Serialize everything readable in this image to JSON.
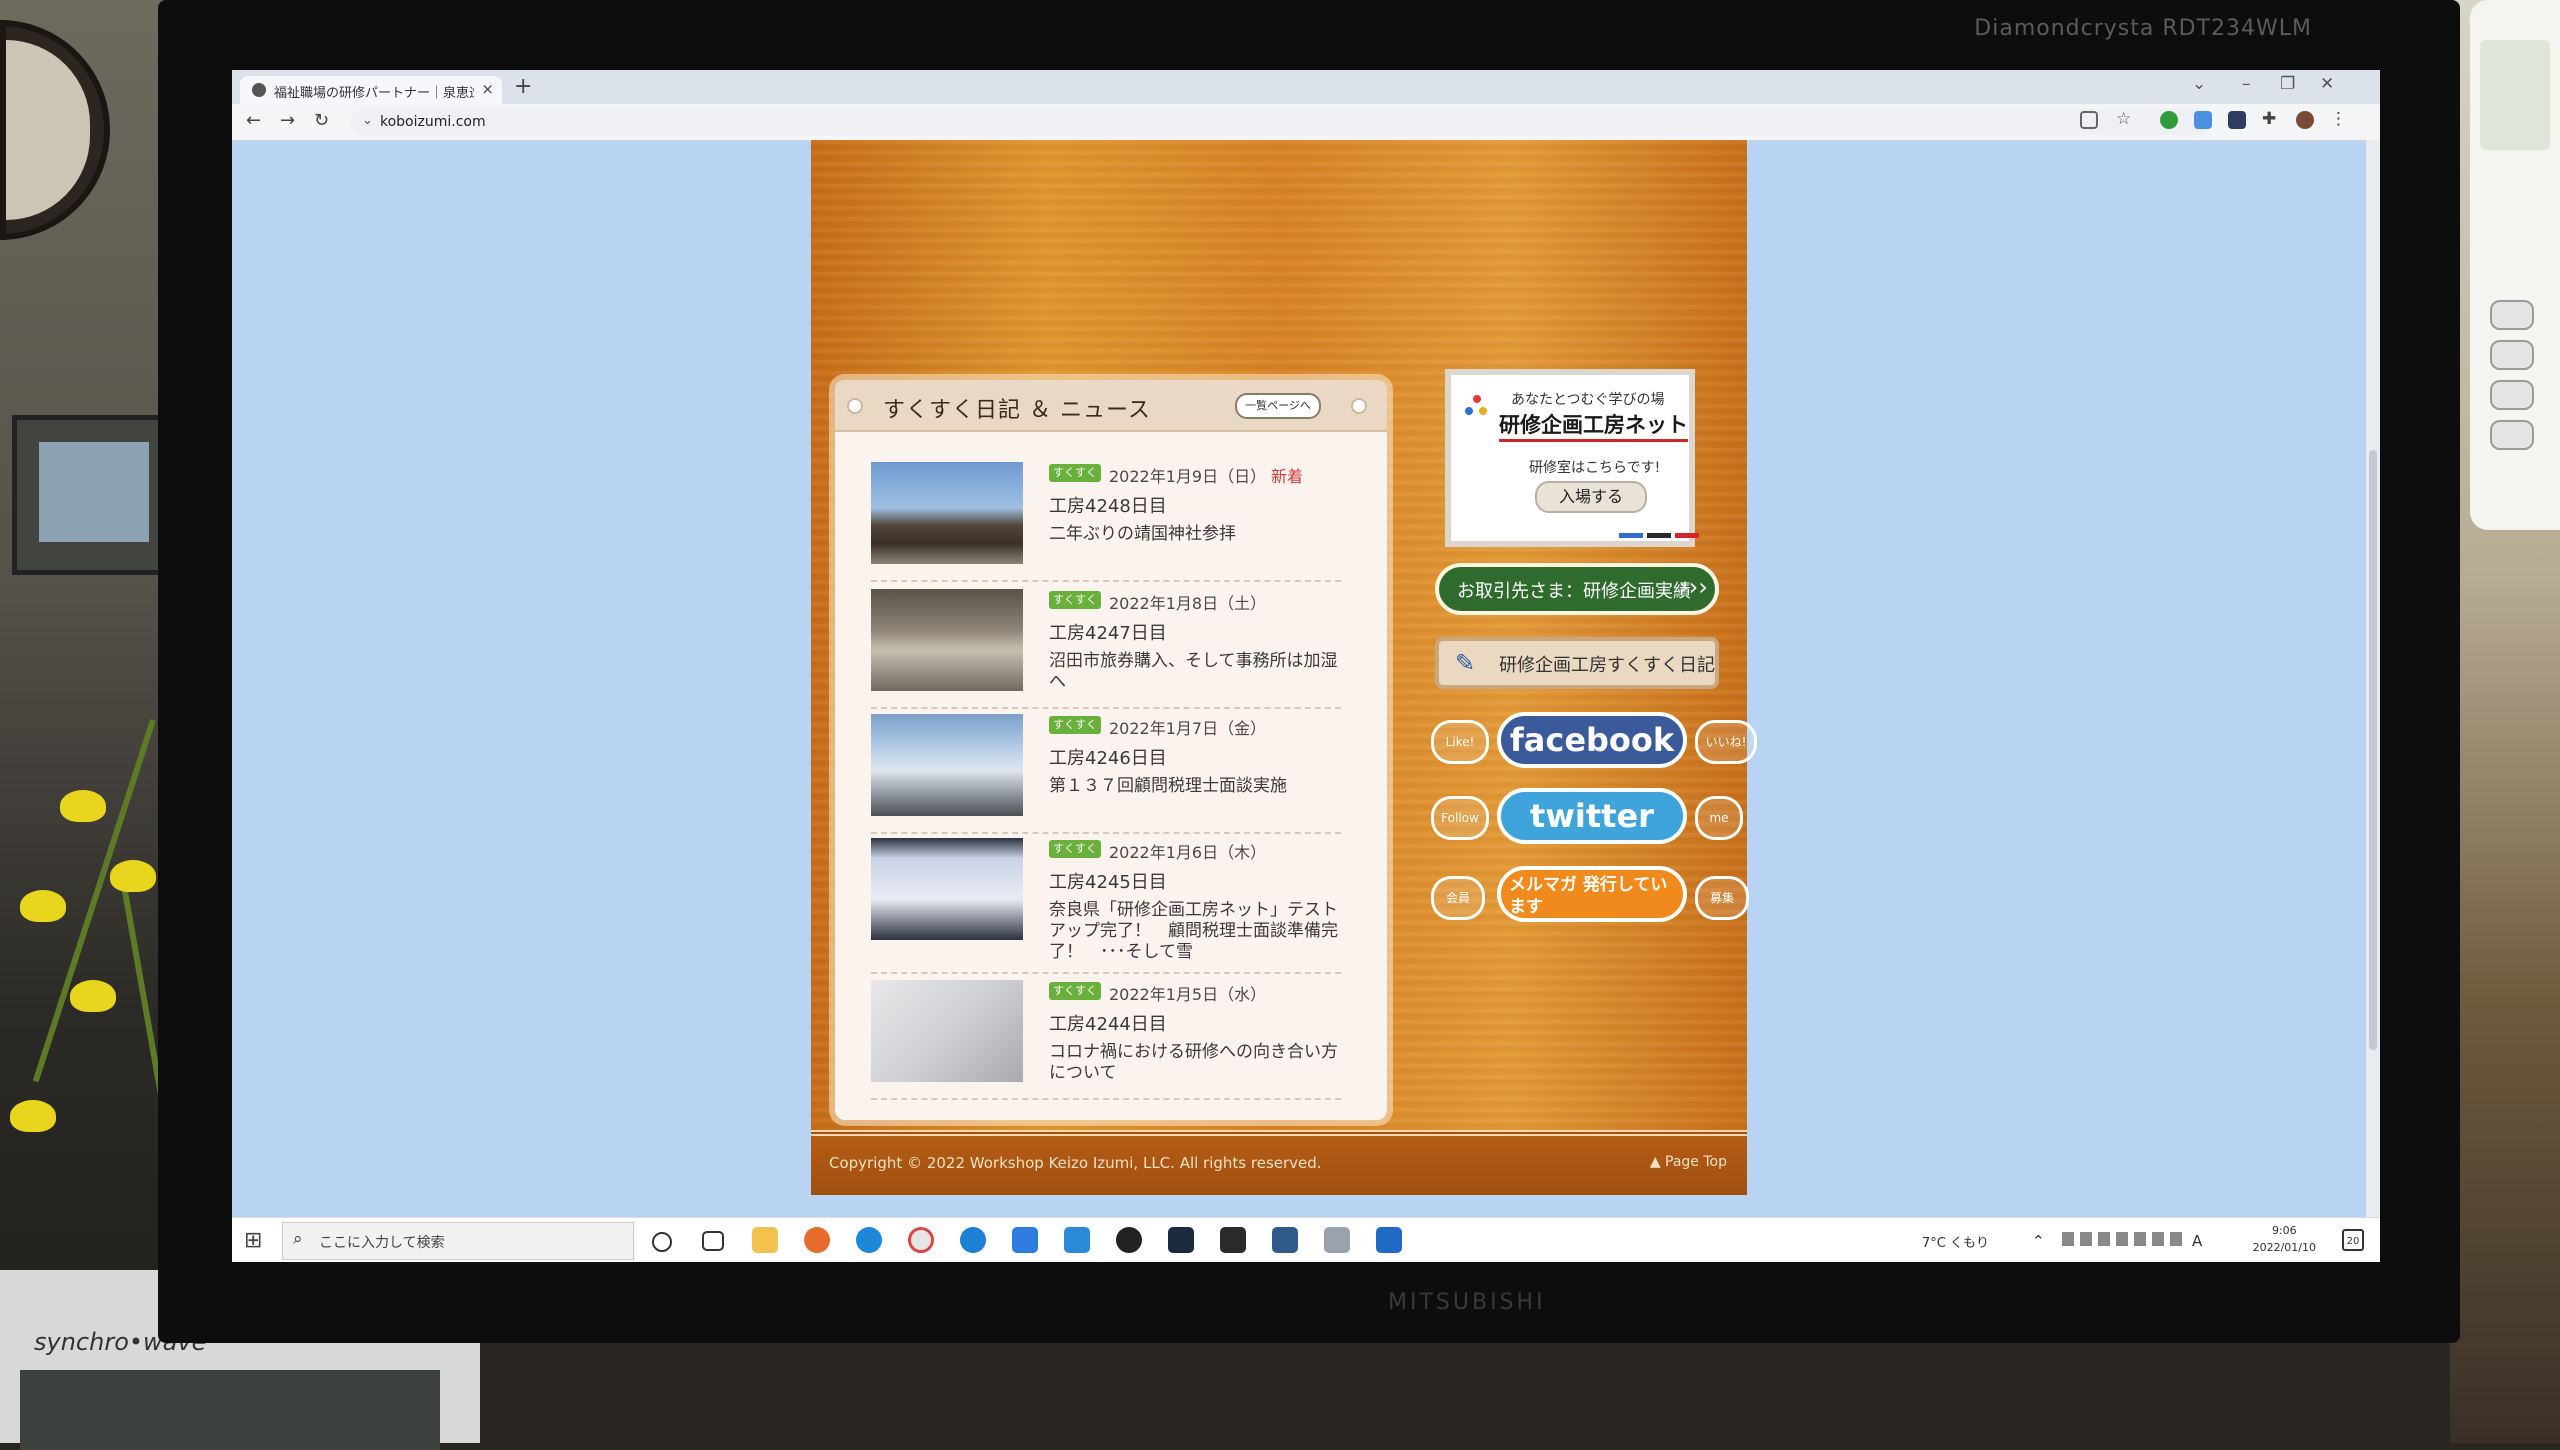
{
  "monitor": {
    "model": "Diamondcrysta RDT234WLM",
    "maker": "MITSUBISHI"
  },
  "radio_clock": {
    "label": "synchro•wave"
  },
  "browser": {
    "tab_title": "福祉職場の研修パートナー｜泉恵造",
    "tab_close": "×",
    "new_tab": "+",
    "url": "koboizumi.com",
    "nav": {
      "back": "←",
      "forward": "→",
      "reload": "↻"
    },
    "window_controls": {
      "dropdown": "⌄",
      "minimize": "–",
      "maximize": "❐",
      "close": "✕"
    }
  },
  "page": {
    "news": {
      "title": "すくすく日記 ＆ ニュース",
      "more_label": "一覧ページへ",
      "entries": [
        {
          "tag": "すくすく",
          "date": "2022年1月9日（日）",
          "badge": "新着",
          "day": "工房4248日目",
          "text": "二年ぶりの靖国神社参拝"
        },
        {
          "tag": "すくすく",
          "date": "2022年1月8日（土）",
          "badge": "",
          "day": "工房4247日目",
          "text": "沼田市旅券購入、そして事務所は加湿へ"
        },
        {
          "tag": "すくすく",
          "date": "2022年1月7日（金）",
          "badge": "",
          "day": "工房4246日目",
          "text": "第１３７回顧問税理士面談実施"
        },
        {
          "tag": "すくすく",
          "date": "2022年1月6日（木）",
          "badge": "",
          "day": "工房4245日目",
          "text": "奈良県「研修企画工房ネット」テストアップ完了！　顧問税理士面談準備完了！　･･･そして雪"
        },
        {
          "tag": "すくすく",
          "date": "2022年1月5日（水）",
          "badge": "",
          "day": "工房4244日目",
          "text": "コロナ禍における研修への向き合い方について"
        }
      ]
    },
    "sidebar": {
      "net_banner": {
        "subtitle": "あなたとつむぐ学びの場",
        "title": "研修企画工房ネット",
        "line": "研修室はこちらです!",
        "button": "入場する"
      },
      "achievements_label": "お取引先さま：研修企画実績",
      "achievements_arrow": "›››",
      "diary_label": "研修企画工房すくすく日記",
      "facebook": {
        "left": "Like!",
        "main": "facebook",
        "right": "いいね!"
      },
      "twitter": {
        "left": "Follow",
        "main": "twitter",
        "right": "me"
      },
      "mailmag": {
        "left": "会員",
        "main": "メルマガ 発行しています",
        "right": "募集"
      }
    },
    "footer": {
      "copyright": "Copyright © 2022 Workshop Keizo Izumi, LLC. All rights reserved.",
      "pagetop": "▲ Page Top"
    }
  },
  "taskbar": {
    "start": "⊞",
    "search_placeholder": "ここに入力して検索",
    "weather": "7°C くもり",
    "ime": "A",
    "time": "9:06",
    "date": "2022/01/10",
    "notification_count": "20"
  },
  "colors": {
    "page_bg": "#b9d4f2",
    "wood": "#d88224",
    "tag_green": "#6ab03d",
    "achievements_bg": "#2f6b2d",
    "facebook_blue": "#3b5a9a",
    "twitter_blue": "#3fa4dc",
    "mailmag_orange": "#f08a1c"
  }
}
